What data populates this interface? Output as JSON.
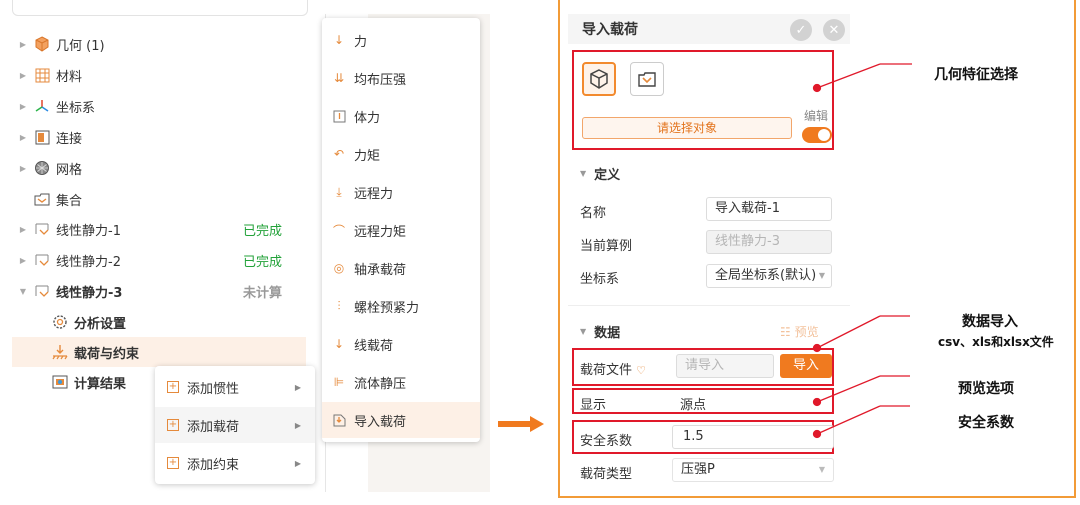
{
  "tree": {
    "items": [
      {
        "label": "几何 (1)"
      },
      {
        "label": "材料"
      },
      {
        "label": "坐标系"
      },
      {
        "label": "连接"
      },
      {
        "label": "网格"
      },
      {
        "label": "集合"
      },
      {
        "label": "线性静力-1",
        "status": "已完成"
      },
      {
        "label": "线性静力-2",
        "status": "已完成"
      },
      {
        "label": "线性静力-3",
        "status": "未计算"
      },
      {
        "label": "分析设置"
      },
      {
        "label": "载荷与约束"
      },
      {
        "label": "计算结果"
      }
    ]
  },
  "context_menu": {
    "items": [
      {
        "label": "添加惯性"
      },
      {
        "label": "添加载荷"
      },
      {
        "label": "添加约束"
      }
    ]
  },
  "submenu": {
    "items": [
      {
        "label": "力"
      },
      {
        "label": "均布压强"
      },
      {
        "label": "体力"
      },
      {
        "label": "力矩"
      },
      {
        "label": "远程力"
      },
      {
        "label": "远程力矩"
      },
      {
        "label": "轴承载荷"
      },
      {
        "label": "螺栓预紧力"
      },
      {
        "label": "线载荷"
      },
      {
        "label": "流体静压"
      },
      {
        "label": "导入载荷"
      }
    ]
  },
  "panel": {
    "title": "导入载荷",
    "ok_glyph": "✓",
    "close_glyph": "✕",
    "select_placeholder": "请选择对象",
    "edit_label": "编辑",
    "definition": {
      "title": "定义",
      "name_label": "名称",
      "name_value": "导入载荷-1",
      "case_label": "当前算例",
      "case_value": "线性静力-3",
      "coord_label": "坐标系",
      "coord_value": "全局坐标系(默认)"
    },
    "data": {
      "title": "数据",
      "preview": "预览",
      "file_label": "载荷文件",
      "file_placeholder": "请导入",
      "import_button": "导入",
      "display_label": "显示",
      "display_value": "源点",
      "safety_label": "安全系数",
      "safety_value": "1.5",
      "load_type_label": "载荷类型",
      "load_type_value": "压强P"
    }
  },
  "annotations": {
    "geometry": "几何特征选择",
    "data_import": "数据导入",
    "data_import_sub": "csv、xls和xlsx文件",
    "preview_option": "预览选项",
    "safety": "安全系数"
  },
  "colors": {
    "accent": "#f07a1f",
    "done": "#23a23a",
    "annotation": "#e0192a",
    "frame": "#f29b37"
  }
}
